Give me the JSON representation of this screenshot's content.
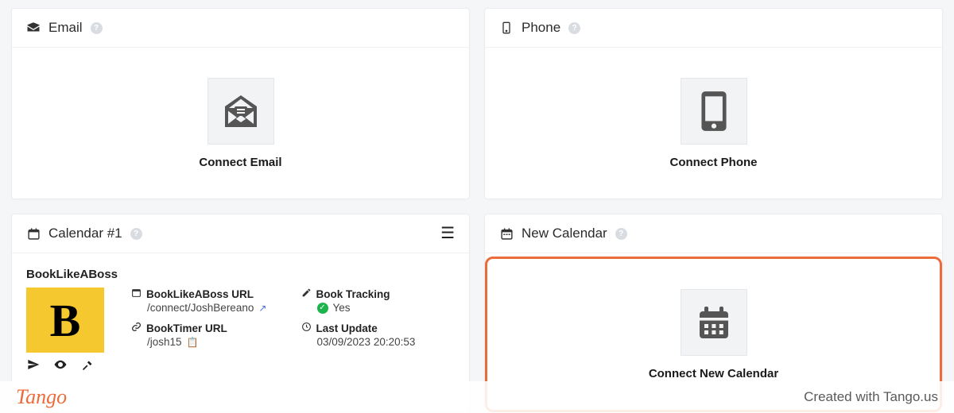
{
  "footer": {
    "brand": "Tango",
    "credit": "Created with Tango.us"
  },
  "cards": {
    "email": {
      "title": "Email",
      "connect_label": "Connect Email"
    },
    "phone": {
      "title": "Phone",
      "connect_label": "Connect Phone"
    },
    "calendar1": {
      "title": "Calendar #1",
      "service_name": "BookLikeABoss",
      "url_label": "BookLikeABoss URL",
      "url_value": "/connect/JoshBereano",
      "timer_label": "BookTimer URL",
      "timer_value": "/josh15",
      "tracking_label": "Book Tracking",
      "tracking_value": "Yes",
      "update_label": "Last Update",
      "update_value": "03/09/2023 20:20:53",
      "logo_letter": "B"
    },
    "newcal": {
      "title": "New Calendar",
      "connect_label": "Connect New Calendar"
    }
  }
}
